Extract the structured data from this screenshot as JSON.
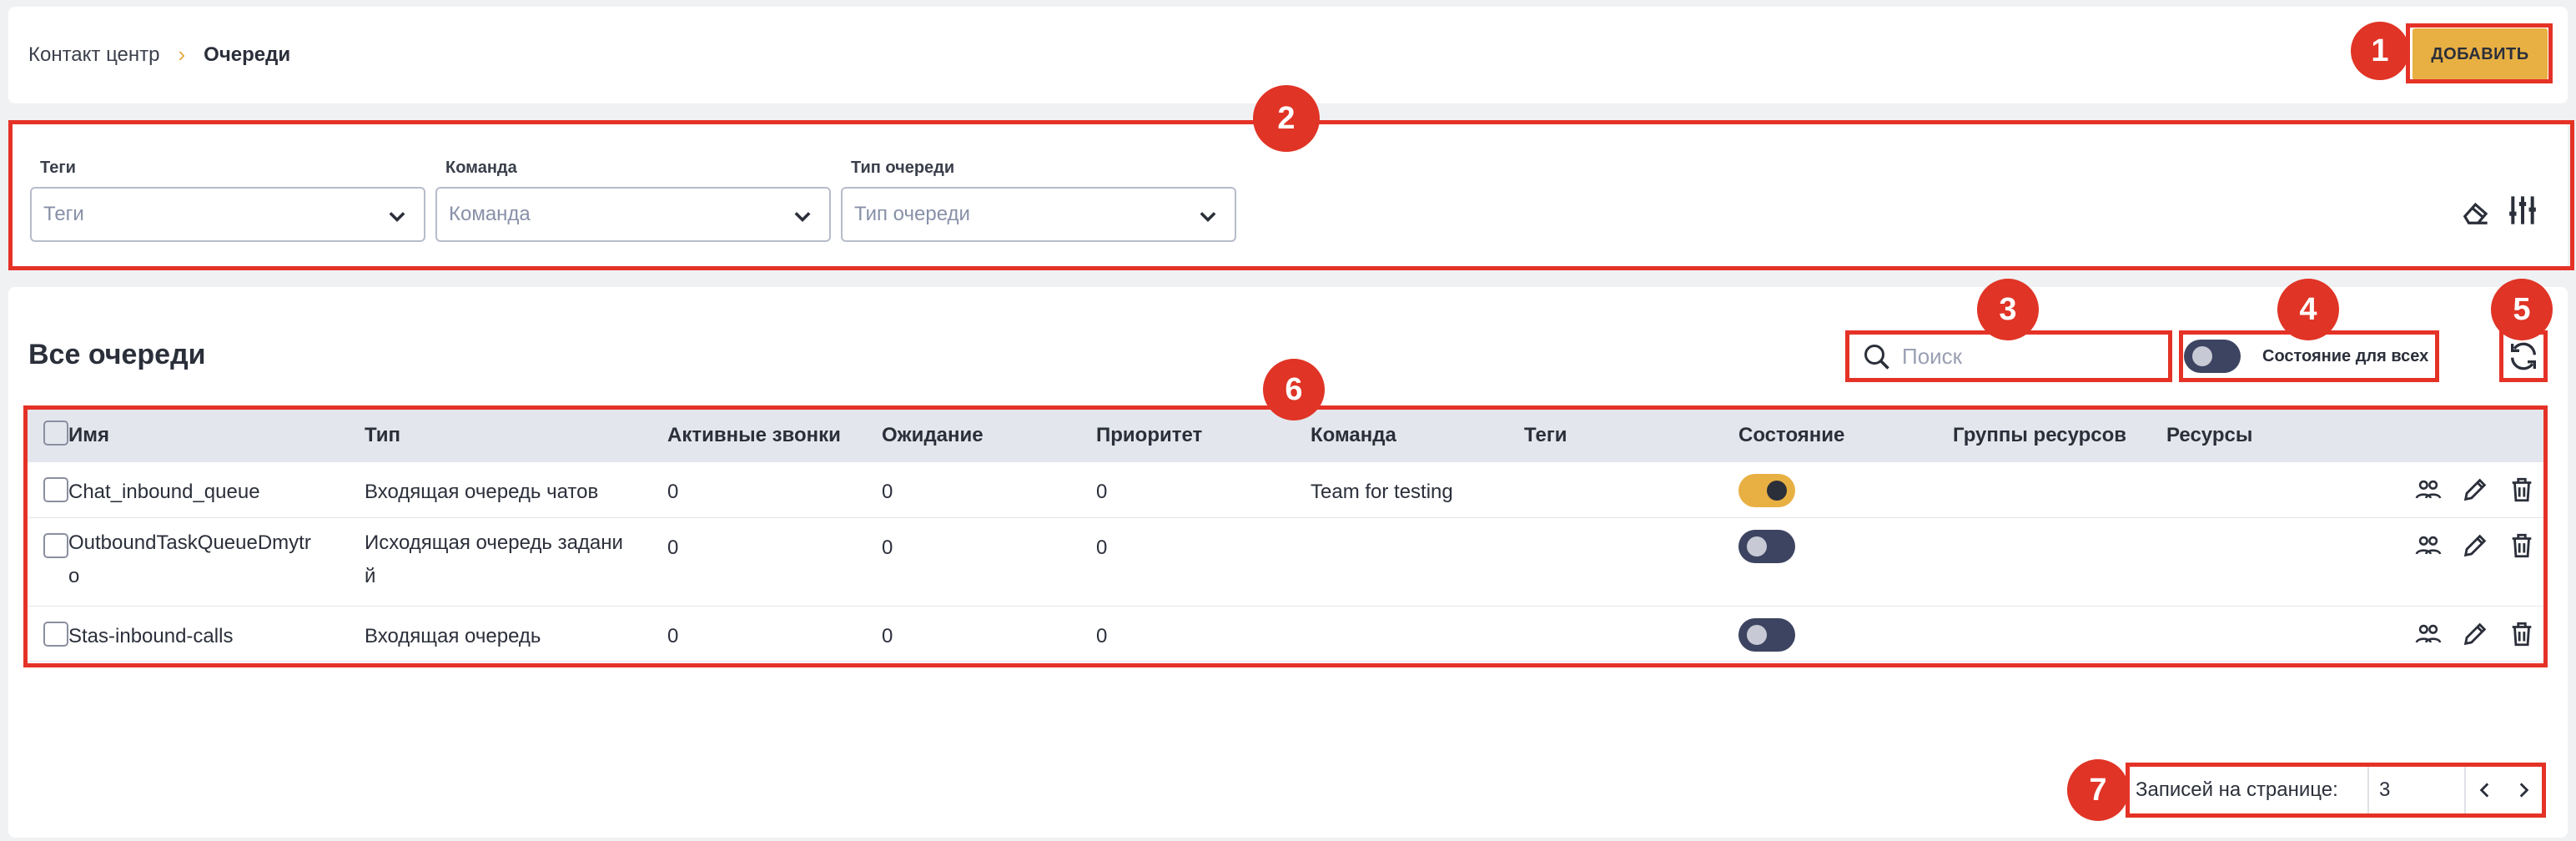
{
  "header": {
    "breadcrumb": {
      "parent": "Контакт центр",
      "separator": "›",
      "current": "Очереди"
    },
    "add_button": "ДОБАВИТЬ"
  },
  "filters": {
    "tags": {
      "label": "Теги",
      "placeholder": "Теги"
    },
    "team": {
      "label": "Команда",
      "placeholder": "Команда"
    },
    "queue_type": {
      "label": "Тип очереди",
      "placeholder": "Тип очереди"
    },
    "icons": [
      "eraser-icon",
      "filter-settings-icon"
    ]
  },
  "queues": {
    "title": "Все очереди",
    "search_placeholder": "Поиск",
    "state_all_label": "Состояние для всех",
    "state_all_on": false,
    "columns": [
      "Имя",
      "Тип",
      "Активные звонки",
      "Ожидание",
      "Приоритет",
      "Команда",
      "Теги",
      "Состояние",
      "Группы ресурсов",
      "Ресурсы"
    ],
    "rows": [
      {
        "name": "Chat_inbound_queue",
        "type": "Входящая очередь чатов",
        "active_calls": "0",
        "waiting": "0",
        "priority": "0",
        "team": "Team for testing",
        "tags": "",
        "state_on": true,
        "resource_groups": "",
        "resources": ""
      },
      {
        "name_line1": "OutboundTaskQueueDmytr",
        "name_line2": "o",
        "type_line1": "Исходящая очередь задани",
        "type_line2": "й",
        "active_calls": "0",
        "waiting": "0",
        "priority": "0",
        "team": "",
        "tags": "",
        "state_on": false,
        "resource_groups": "",
        "resources": ""
      },
      {
        "name": "Stas-inbound-calls",
        "type": "Входящая очередь",
        "active_calls": "0",
        "waiting": "0",
        "priority": "0",
        "team": "",
        "tags": "",
        "state_on": false,
        "resource_groups": "",
        "resources": ""
      }
    ],
    "row_actions": [
      "users-icon",
      "pencil-icon",
      "trash-icon"
    ]
  },
  "pagination": {
    "label": "Записей на странице:",
    "page_size": "3"
  },
  "markers": [
    "1",
    "2",
    "3",
    "4",
    "5",
    "6",
    "7"
  ],
  "colors": {
    "accent": "#e8b043",
    "highlight": "#e53226",
    "marker": "#e03426",
    "toggle_off": "#3d4461"
  }
}
